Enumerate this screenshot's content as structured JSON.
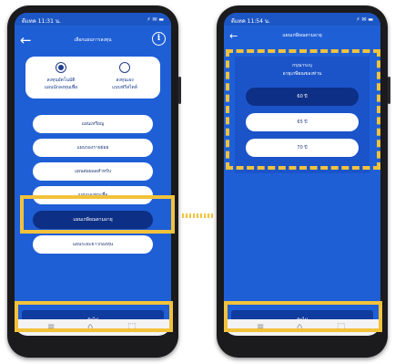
{
  "left_phone": {
    "status": {
      "left": "ดีแทค 11:31 น.",
      "right": "⚡ ✉ ▬"
    },
    "header": {
      "back_icon": "←",
      "title": "เลือกแผนการลงทุน",
      "info_icon": "i"
    },
    "options": [
      {
        "label_line1": "ลงทุนอัตโนมัติ",
        "label_line2": "แผนนักลงทุนเพื่อ",
        "selected": true
      },
      {
        "label_line1": "ลงทุนเอง",
        "label_line2": "แบบฟรีสไตล์",
        "selected": false
      }
    ],
    "plans": [
      {
        "label": "แผนเหรียญ"
      },
      {
        "label": "แผนรองรายย่อย"
      },
      {
        "label": "แผนต่อยอดสำหรับ"
      },
      {
        "label": "แผนกองทุนเพื่อ"
      },
      {
        "label": "แผนเกษียณตามอายุ",
        "selected": true
      },
      {
        "label": "แผนระยะยาวกองทุน"
      }
    ],
    "continue_label": "ถัดไป"
  },
  "right_phone": {
    "status": {
      "left": "ดีแทค 11:54 น.",
      "right": "⚡ ✉ ▬"
    },
    "header": {
      "back_icon": "←",
      "title": "แผนเกษียณตามอายุ"
    },
    "prompt": {
      "line1": "กรุณาระบุ",
      "line2": "อายุเกษียณของท่าน"
    },
    "ages": [
      {
        "label": "60 ปี",
        "selected": true
      },
      {
        "label": "65 ปี"
      },
      {
        "label": "70 ปี"
      }
    ],
    "continue_label": "ถัดไป"
  },
  "nav": {
    "menu_icon": "≡",
    "home_icon": "⌂",
    "back_icon": "⬚"
  },
  "colors": {
    "brand_blue": "#1f5fd6",
    "dark_blue": "#0d2f85",
    "highlight": "#f2c23c"
  }
}
